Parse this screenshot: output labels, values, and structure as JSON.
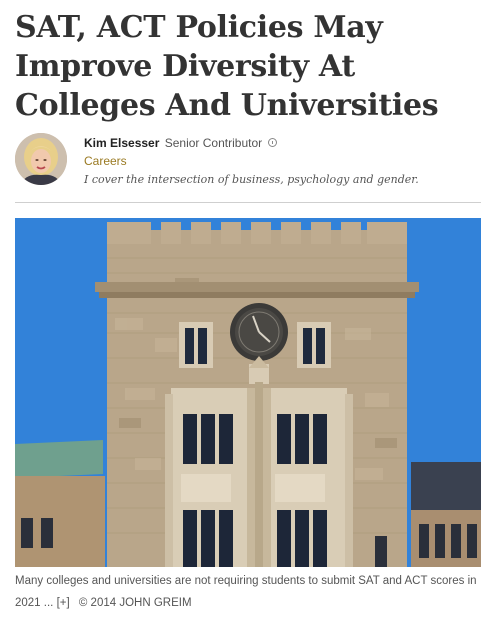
{
  "article": {
    "headline": "SAT, ACT Policies May Improve Diversity At Colleges And Universities"
  },
  "byline": {
    "author_name": "Kim Elsesser",
    "author_role": "Senior Contributor",
    "info_icon": "info-icon",
    "section": "Careers",
    "bio": "I cover the intersection of business, psychology and gender."
  },
  "image": {
    "caption_text": "Many colleges and universities are not requiring students to submit SAT and ACT scores in 2021 ...",
    "expand_label": "[+]",
    "credit": "© 2014 JOHN GREIM",
    "colors": {
      "sky": "#2f7fd6",
      "stone": "#b9a68a",
      "roof": "#6fa08e"
    }
  }
}
